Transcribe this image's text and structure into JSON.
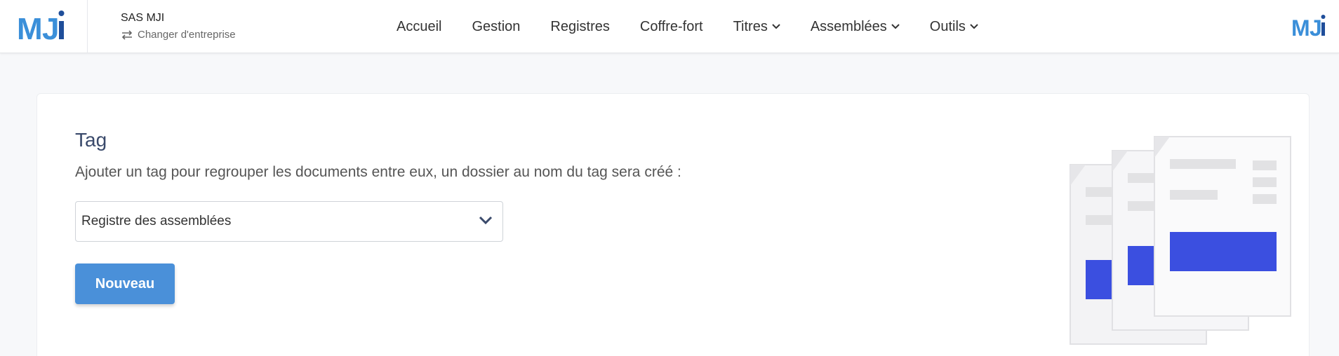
{
  "header": {
    "logo_text": "MJi",
    "company_name": "SAS MJI",
    "switch_label": "Changer d'entreprise",
    "nav": [
      {
        "label": "Accueil",
        "dropdown": false
      },
      {
        "label": "Gestion",
        "dropdown": false
      },
      {
        "label": "Registres",
        "dropdown": false
      },
      {
        "label": "Coffre-fort",
        "dropdown": false
      },
      {
        "label": "Titres",
        "dropdown": true
      },
      {
        "label": "Assemblées",
        "dropdown": true
      },
      {
        "label": "Outils",
        "dropdown": true
      }
    ]
  },
  "tag": {
    "title": "Tag",
    "description": "Ajouter un tag pour regrouper les documents entre eux, un dossier au nom du tag sera créé :",
    "selected": "Registre des assemblées",
    "new_button": "Nouveau"
  },
  "colors": {
    "primary": "#4a90d9",
    "title": "#3a4a6b",
    "accent_blue": "#3b4fe0",
    "logo_blue": "#3b8fd9",
    "logo_dark": "#1f4e9a"
  },
  "icons": [
    "switch-arrows-icon",
    "chevron-down-icon",
    "documents-illustration"
  ]
}
